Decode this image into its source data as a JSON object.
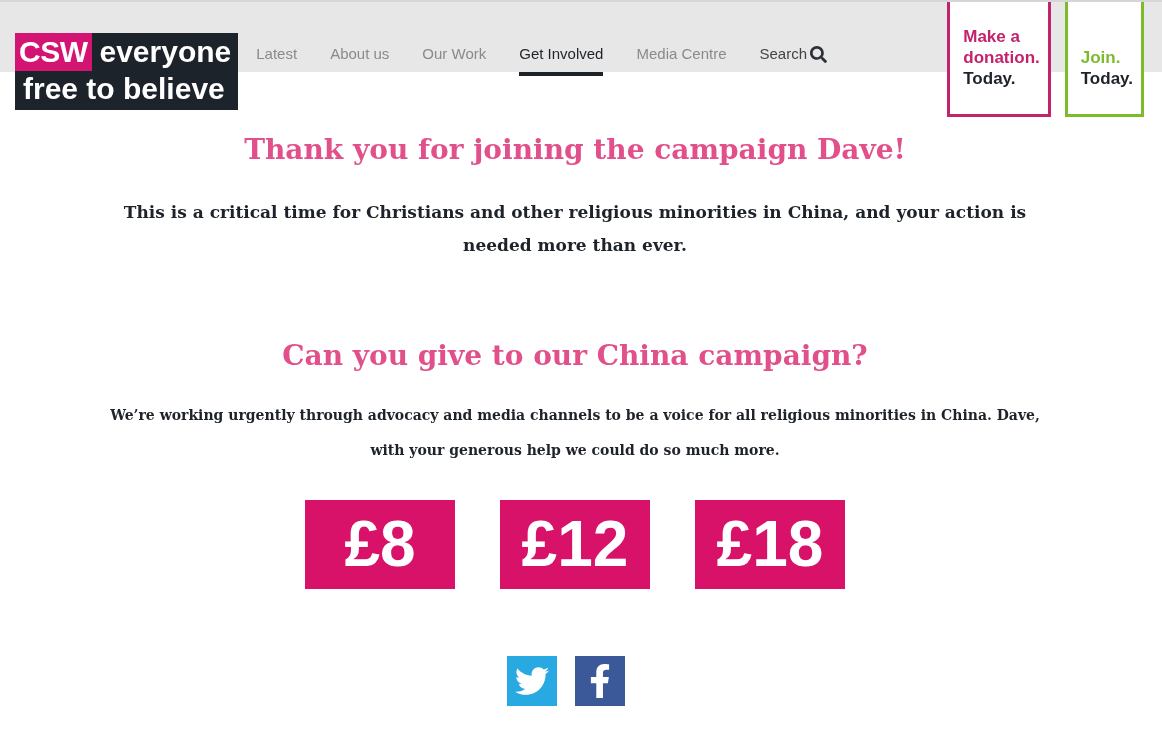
{
  "header": {
    "logo": {
      "badge": "CSW",
      "lines": [
        "everyone",
        "free to believe"
      ]
    },
    "nav": [
      {
        "label": "Latest",
        "selected": false
      },
      {
        "label": "About us",
        "selected": false
      },
      {
        "label": "Our Work",
        "selected": false
      },
      {
        "label": "Get Involved",
        "selected": true
      },
      {
        "label": "Media Centre",
        "selected": false
      }
    ],
    "search": {
      "label": "Search"
    },
    "cta_boxes": [
      {
        "highlight": "Make a donation.",
        "text": "Today.",
        "color": "#c4236b"
      },
      {
        "highlight": "Join.",
        "text": "Today.",
        "color": "#7cbb2c"
      }
    ]
  },
  "main": {
    "title": "Thank you for joining the campaign Dave!",
    "intro": "This is a critical time for Christians and other religious minorities in China, and your action is needed more than ever.",
    "appeal": {
      "title": "Can you give to our China campaign?",
      "text": "We’re working urgently through advocacy and media channels to be a voice for all religious minorities in China. Dave, with your generous help we could do so much more."
    },
    "amounts": [
      "£8",
      "£12",
      "£18"
    ]
  }
}
